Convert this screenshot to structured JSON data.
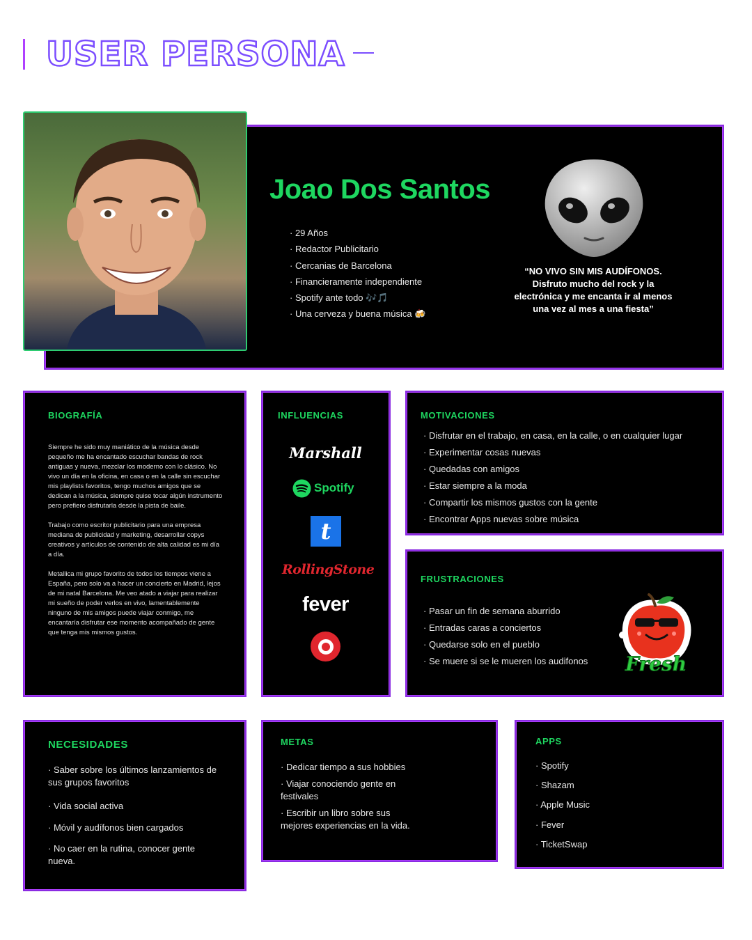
{
  "header": {
    "title": "USER PERSONA"
  },
  "profile": {
    "name": "Joao Dos Santos",
    "facts": [
      "29 Años",
      "Redactor Publicitario",
      "Cercanias de Barcelona",
      "Financieramente independiente",
      "Spotify ante todo 🎶🎵",
      "Una cerveza y buena música 🍻"
    ],
    "quote": "“NO VIVO SIN MIS AUDÍFONOS. Disfruto mucho del rock y la electrónica y me encanta ir al menos una vez al mes a una fiesta”"
  },
  "biography": {
    "heading": "BIOGRAFÍA",
    "paragraphs": [
      "Siempre he sido muy maniático de la música desde pequeño me ha encantado escuchar bandas de rock antiguas y nueva, mezclar los moderno con lo clásico. No vivo un día en la oficina, en casa o en la calle sin escuchar mis playlists favoritos, tengo muchos amigos que se dedican a la música, siempre quise tocar algún instrumento pero prefiero disfrutarla desde la pista de baile.",
      "Trabajo como escritor publicitario para una empresa mediana de publicidad y marketing, desarrollar copys creativos y artículos de contenido de alta calidad es mi día a día.",
      "Metallica mi grupo favorito de todos los tiempos viene a España, pero solo va a hacer un concierto en Madrid, lejos de mi natal Barcelona. Me veo atado a viajar para realizar mi sueño de poder verlos en vivo, lamentablemente ninguno de mis amigos puede viajar conmigo, me encantaría disfrutar ese momento acompañado de gente que tenga mis mismos gustos."
    ]
  },
  "influences": {
    "heading": "INFLUENCIAS",
    "logos": [
      "Marshall",
      "Spotify",
      "t",
      "RollingStone",
      "fever",
      "b"
    ]
  },
  "motivations": {
    "heading": "MOTIVACIONES",
    "items": [
      "Disfrutar en el trabajo, en casa, en la calle, o en cualquier lugar",
      "Experimentar cosas nuevas",
      "Quedadas con amigos",
      "Estar siempre a la moda",
      "Compartir los mismos gustos con la gente",
      "Encontrar Apps nuevas sobre música"
    ]
  },
  "frustrations": {
    "heading": "FRUSTRACIONES",
    "items": [
      "Pasar un fin de semana aburrido",
      "Entradas caras a conciertos",
      "Quedarse solo en el pueblo",
      "Se muere si se le mueren los audifonos"
    ],
    "sticker_text": "Fresh"
  },
  "needs": {
    "heading": "NECESIDADES",
    "items": [
      "Saber sobre los últimos lanzamientos de sus grupos favoritos",
      "Vida social activa",
      "Móvil y audífonos bien cargados",
      "No caer en la rutina, conocer gente nueva."
    ]
  },
  "goals": {
    "heading": "METAS",
    "items": [
      "Dedicar tiempo a sus hobbies",
      "Viajar conociendo gente en festivales",
      "Escribir un libro sobre sus mejores experiencias en la vida."
    ]
  },
  "apps": {
    "heading": "APPS",
    "items": [
      "Spotify",
      "Shazam",
      "Apple Music",
      "Fever",
      "TicketSwap"
    ]
  },
  "colors": {
    "accent_green": "#1ed760",
    "border_purple": "#8a2be2",
    "card_bg": "#000000"
  }
}
